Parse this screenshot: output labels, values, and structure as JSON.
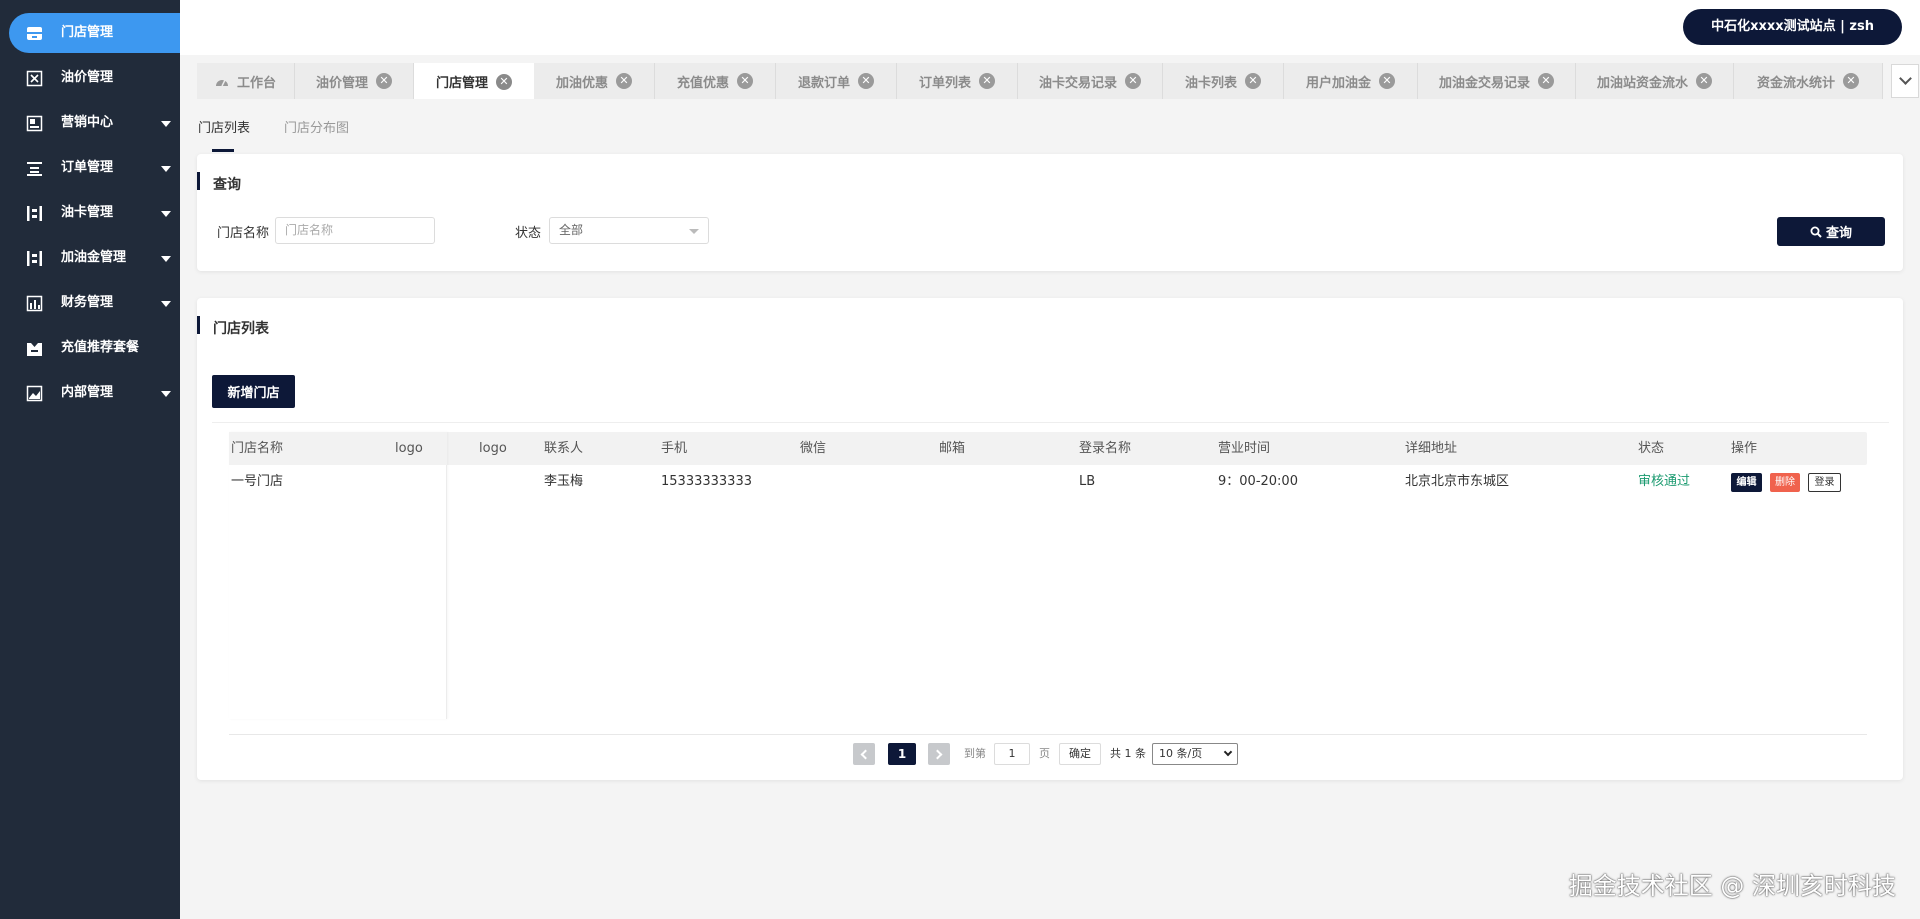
{
  "header": {
    "user_label": "中石化xxxx测试站点 | zsh"
  },
  "sidebar": {
    "items": [
      {
        "label": "门店管理",
        "icon": "store-icon",
        "active": true,
        "expandable": false
      },
      {
        "label": "油价管理",
        "icon": "price-icon",
        "active": false,
        "expandable": false
      },
      {
        "label": "营销中心",
        "icon": "marketing-icon",
        "active": false,
        "expandable": true
      },
      {
        "label": "订单管理",
        "icon": "order-icon",
        "active": false,
        "expandable": true
      },
      {
        "label": "油卡管理",
        "icon": "card-icon",
        "active": false,
        "expandable": true
      },
      {
        "label": "加油金管理",
        "icon": "fuel-gold-icon",
        "active": false,
        "expandable": true
      },
      {
        "label": "财务管理",
        "icon": "finance-icon",
        "active": false,
        "expandable": true
      },
      {
        "label": "充值推荐套餐",
        "icon": "package-icon",
        "active": false,
        "expandable": false
      },
      {
        "label": "内部管理",
        "icon": "internal-icon",
        "active": false,
        "expandable": true
      }
    ]
  },
  "tabs": [
    {
      "label": "工作台",
      "closable": false,
      "active": false
    },
    {
      "label": "油价管理",
      "closable": true,
      "active": false
    },
    {
      "label": "门店管理",
      "closable": true,
      "active": true
    },
    {
      "label": "加油优惠",
      "closable": true,
      "active": false
    },
    {
      "label": "充值优惠",
      "closable": true,
      "active": false
    },
    {
      "label": "退款订单",
      "closable": true,
      "active": false
    },
    {
      "label": "订单列表",
      "closable": true,
      "active": false
    },
    {
      "label": "油卡交易记录",
      "closable": true,
      "active": false
    },
    {
      "label": "油卡列表",
      "closable": true,
      "active": false
    },
    {
      "label": "用户加油金",
      "closable": true,
      "active": false
    },
    {
      "label": "加油金交易记录",
      "closable": true,
      "active": false
    },
    {
      "label": "加油站资金流水",
      "closable": true,
      "active": false
    },
    {
      "label": "资金流水统计",
      "closable": true,
      "active": false
    }
  ],
  "subtabs": [
    {
      "label": "门店列表",
      "active": true
    },
    {
      "label": "门店分布图",
      "active": false
    }
  ],
  "query": {
    "title": "查询",
    "name_label": "门店名称",
    "name_placeholder": "门店名称",
    "status_label": "状态",
    "status_value": "全部",
    "search_label": "查询"
  },
  "list": {
    "title": "门店列表",
    "add_label": "新增门店",
    "columns": [
      "门店名称",
      "logo",
      "logo",
      "联系人",
      "手机",
      "微信",
      "邮箱",
      "登录名称",
      "营业时间",
      "详细地址",
      "状态",
      "操作"
    ],
    "rows": [
      {
        "name": "一号门店",
        "contact": "李玉梅",
        "phone": "15333333333",
        "wechat": "",
        "email": "",
        "login": "LB",
        "hours": "9：00-20:00",
        "address": "北京北京市东城区",
        "status": "审核通过",
        "ops": {
          "edit": "编辑",
          "delete": "删除",
          "login": "登录"
        }
      }
    ]
  },
  "pagination": {
    "current": "1",
    "goto_prefix": "到第",
    "goto_value": "1",
    "goto_suffix": "页",
    "confirm": "确定",
    "total": "共 1 条",
    "page_size": "10 条/页"
  },
  "watermark": "掘金技术社区 @ 深圳亥时科技",
  "colors": {
    "sidebar_bg": "#212b3a",
    "active_blue": "#3d98f0",
    "primary_navy": "#0d1838",
    "danger": "#f0624d",
    "success": "#1a9a6f"
  }
}
